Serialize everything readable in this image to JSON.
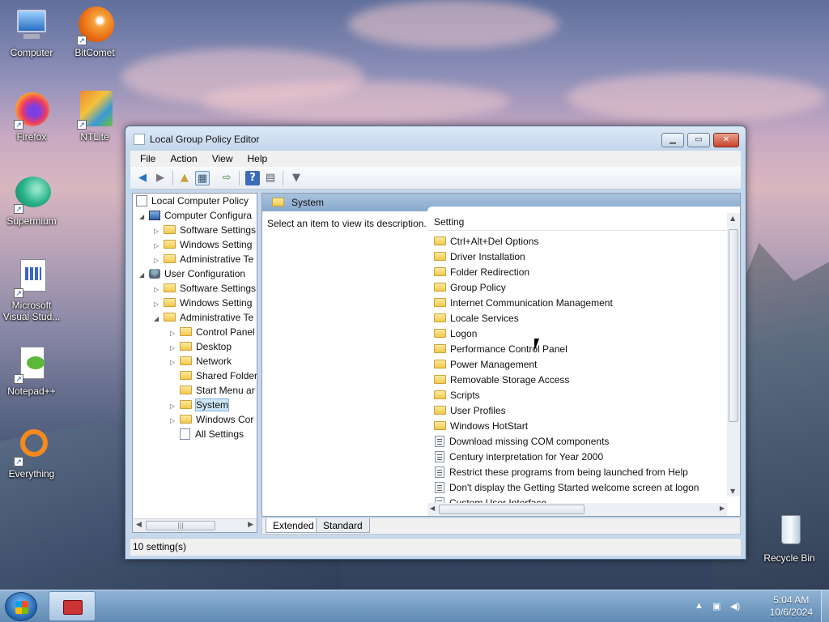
{
  "desktop": {
    "icons": [
      {
        "label": "Computer"
      },
      {
        "label": "BitComet"
      },
      {
        "label": "Firefox"
      },
      {
        "label": "NTLite"
      },
      {
        "label": "Supermium"
      },
      {
        "label": "Microsoft Visual Stud..."
      },
      {
        "label": "Notepad++"
      },
      {
        "label": "Everything"
      },
      {
        "label": "Recycle Bin"
      }
    ]
  },
  "window": {
    "title": "Local Group Policy Editor",
    "menu": [
      "File",
      "Action",
      "View",
      "Help"
    ],
    "toolbar_icons": [
      "back-arrow-icon",
      "forward-arrow-icon",
      "up-folder-icon",
      "show-hide-tree-icon",
      "export-list-icon",
      "help-icon",
      "properties-icon",
      "filter-icon"
    ],
    "tree": [
      {
        "label": "Local Computer Policy",
        "level": 0,
        "expander": "",
        "icon": "computer-policy"
      },
      {
        "label": "Computer Configura",
        "level": 1,
        "expander": "◢",
        "icon": "computer"
      },
      {
        "label": "Software Settings",
        "level": 2,
        "expander": "▷",
        "icon": "folder"
      },
      {
        "label": "Windows Setting",
        "level": 2,
        "expander": "▷",
        "icon": "folder"
      },
      {
        "label": "Administrative Te",
        "level": 2,
        "expander": "▷",
        "icon": "folder"
      },
      {
        "label": "User Configuration",
        "level": 1,
        "expander": "◢",
        "icon": "user"
      },
      {
        "label": "Software Settings",
        "level": 2,
        "expander": "▷",
        "icon": "folder"
      },
      {
        "label": "Windows Setting",
        "level": 2,
        "expander": "▷",
        "icon": "folder"
      },
      {
        "label": "Administrative Te",
        "level": 2,
        "expander": "◢",
        "icon": "folder"
      },
      {
        "label": "Control Panel",
        "level": 3,
        "expander": "▷",
        "icon": "folder"
      },
      {
        "label": "Desktop",
        "level": 3,
        "expander": "▷",
        "icon": "folder"
      },
      {
        "label": "Network",
        "level": 3,
        "expander": "▷",
        "icon": "folder"
      },
      {
        "label": "Shared Folder",
        "level": 3,
        "expander": "",
        "icon": "folder"
      },
      {
        "label": "Start Menu ar",
        "level": 3,
        "expander": "",
        "icon": "folder"
      },
      {
        "label": "System",
        "level": 3,
        "expander": "▷",
        "icon": "folder",
        "selected": true
      },
      {
        "label": "Windows Cor",
        "level": 3,
        "expander": "▷",
        "icon": "folder"
      },
      {
        "label": "All Settings",
        "level": 3,
        "expander": "",
        "icon": "all-settings"
      }
    ],
    "right_pane": {
      "header": "System",
      "description": "Select an item to view its description.",
      "column_header": "Setting",
      "items": [
        {
          "label": "Ctrl+Alt+Del Options",
          "type": "folder"
        },
        {
          "label": "Driver Installation",
          "type": "folder"
        },
        {
          "label": "Folder Redirection",
          "type": "folder"
        },
        {
          "label": "Group Policy",
          "type": "folder"
        },
        {
          "label": "Internet Communication Management",
          "type": "folder"
        },
        {
          "label": "Locale Services",
          "type": "folder"
        },
        {
          "label": "Logon",
          "type": "folder"
        },
        {
          "label": "Performance Control Panel",
          "type": "folder"
        },
        {
          "label": "Power Management",
          "type": "folder"
        },
        {
          "label": "Removable Storage Access",
          "type": "folder"
        },
        {
          "label": "Scripts",
          "type": "folder"
        },
        {
          "label": "User Profiles",
          "type": "folder"
        },
        {
          "label": "Windows HotStart",
          "type": "folder"
        },
        {
          "label": "Download missing COM components",
          "type": "setting"
        },
        {
          "label": "Century interpretation for Year 2000",
          "type": "setting"
        },
        {
          "label": "Restrict these programs from being launched from Help",
          "type": "setting"
        },
        {
          "label": "Don't display the Getting Started welcome screen at logon",
          "type": "setting"
        },
        {
          "label": "Custom User Interface",
          "type": "setting"
        }
      ]
    },
    "tabs": [
      "Extended",
      "Standard"
    ],
    "status": "10 setting(s)"
  },
  "taskbar": {
    "time": "5:04 AM",
    "date": "10/6/2024"
  }
}
